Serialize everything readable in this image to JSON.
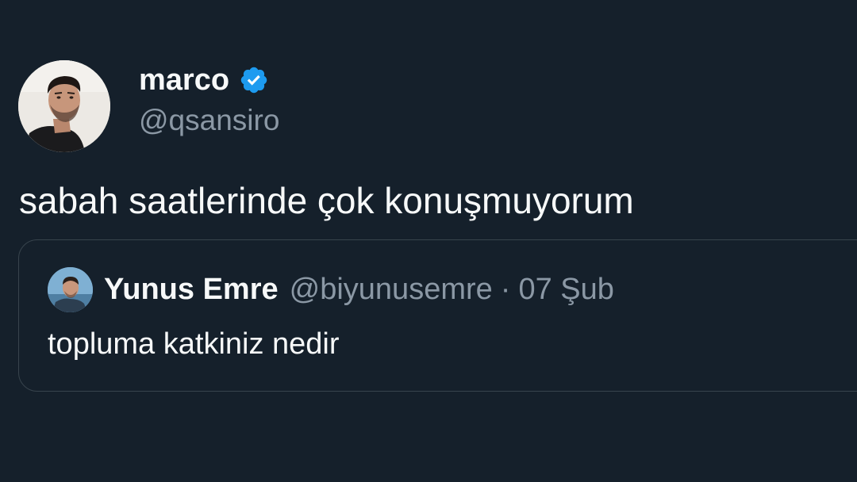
{
  "author": {
    "name": "marco",
    "handle": "@qsansiro",
    "verified": true,
    "avatar_icon": "user-photo-avatar"
  },
  "tweet": {
    "text": "sabah saatlerinde çok konuşmuyorum"
  },
  "quoted_tweet": {
    "author_name": "Yunus Emre",
    "author_handle": "@biyunusemre",
    "separator": "·",
    "date": "07 Şub",
    "text": "topluma katkiniz nedir",
    "avatar_icon": "user-photo-avatar"
  },
  "colors": {
    "background": "#15202b",
    "text_primary": "#f7f9f9",
    "text_secondary": "#8b98a5",
    "verified_badge": "#1d9bf0",
    "card_border": "#38444d"
  }
}
